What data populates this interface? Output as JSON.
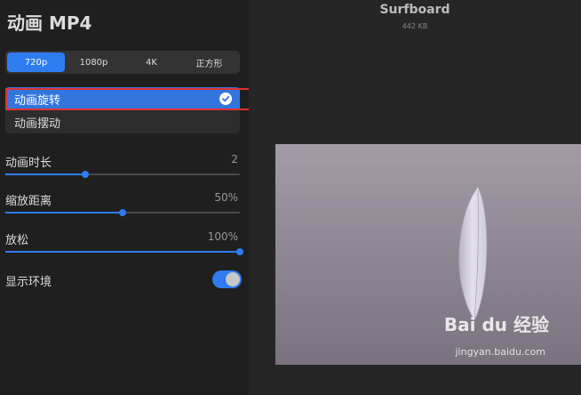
{
  "panel": {
    "title": "动画 MP4"
  },
  "resolution": {
    "options": [
      "720p",
      "1080p",
      "4K",
      "正方形"
    ],
    "selected": "720p"
  },
  "animation": {
    "items": [
      {
        "label": "动画旋转",
        "selected": true
      },
      {
        "label": "动画摆动",
        "selected": false
      }
    ]
  },
  "sliders": [
    {
      "label": "动画时长",
      "value_text": "2",
      "fraction": 0.34
    },
    {
      "label": "缩放距离",
      "value_text": "50%",
      "fraction": 0.5
    },
    {
      "label": "放松",
      "value_text": "100%",
      "fraction": 1.0
    }
  ],
  "environment": {
    "label": "显示环境",
    "enabled": true
  },
  "file": {
    "name": "Surfboard",
    "size": "442 KB"
  },
  "watermark": {
    "brand": "Bai du 经验",
    "url": "jingyan.baidu.com"
  },
  "colors": {
    "accent": "#2f7cf0",
    "highlight": "#e03131"
  }
}
